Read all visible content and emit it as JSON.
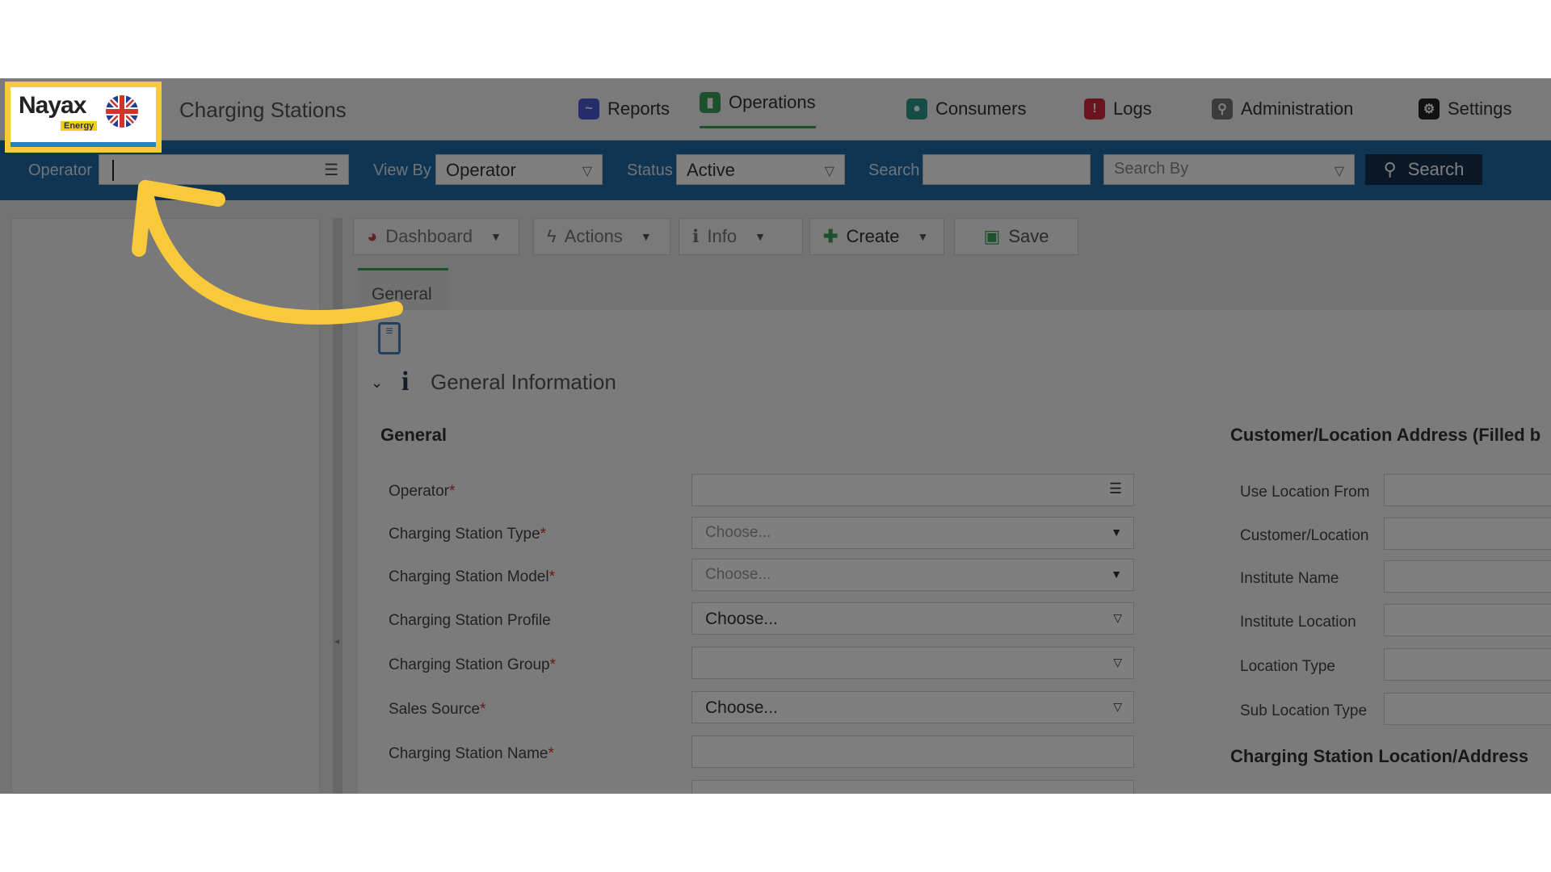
{
  "app": {
    "brand": "Nayax",
    "brand_sub": "Energy",
    "page_title": "Charging Stations"
  },
  "nav": {
    "reports": "Reports",
    "operations": "Operations",
    "consumers": "Consumers",
    "logs": "Logs",
    "administration": "Administration",
    "settings": "Settings"
  },
  "filter": {
    "operator_label": "Operator",
    "operator_value": "",
    "viewby_label": "View By",
    "viewby_value": "Operator",
    "status_label": "Status",
    "status_value": "Active",
    "search_label": "Search",
    "search_value": "",
    "searchby_placeholder": "Search By",
    "search_button": "Search"
  },
  "toolbar": {
    "dashboard": "Dashboard",
    "actions": "Actions",
    "info": "Info",
    "create": "Create",
    "save": "Save"
  },
  "tabs": {
    "general": "General"
  },
  "form": {
    "section_title": "General Information",
    "left_heading": "General",
    "right_heading": "Customer/Location Address (Filled b",
    "right_heading2": "Charging Station Location/Address",
    "fields": [
      {
        "label": "Operator",
        "required": "*",
        "value": ""
      },
      {
        "label": "Charging Station Type",
        "required": "*",
        "value": "Choose..."
      },
      {
        "label": "Charging Station Model",
        "required": "*",
        "value": "Choose..."
      },
      {
        "label": "Charging Station Profile",
        "required": "",
        "value": "Choose..."
      },
      {
        "label": "Charging Station Group",
        "required": "*",
        "value": ""
      },
      {
        "label": "Sales Source",
        "required": "*",
        "value": "Choose..."
      },
      {
        "label": "Charging Station Name",
        "required": "*",
        "value": ""
      }
    ],
    "right_fields": [
      {
        "label": "Use Location From"
      },
      {
        "label": "Customer/Location"
      },
      {
        "label": "Institute Name"
      },
      {
        "label": "Institute Location"
      },
      {
        "label": "Location Type"
      },
      {
        "label": "Sub Location Type"
      }
    ]
  },
  "colors": {
    "filterbar": "#1e6aa7",
    "highlight": "#f8c93b",
    "accent_green": "#3aa35a"
  }
}
